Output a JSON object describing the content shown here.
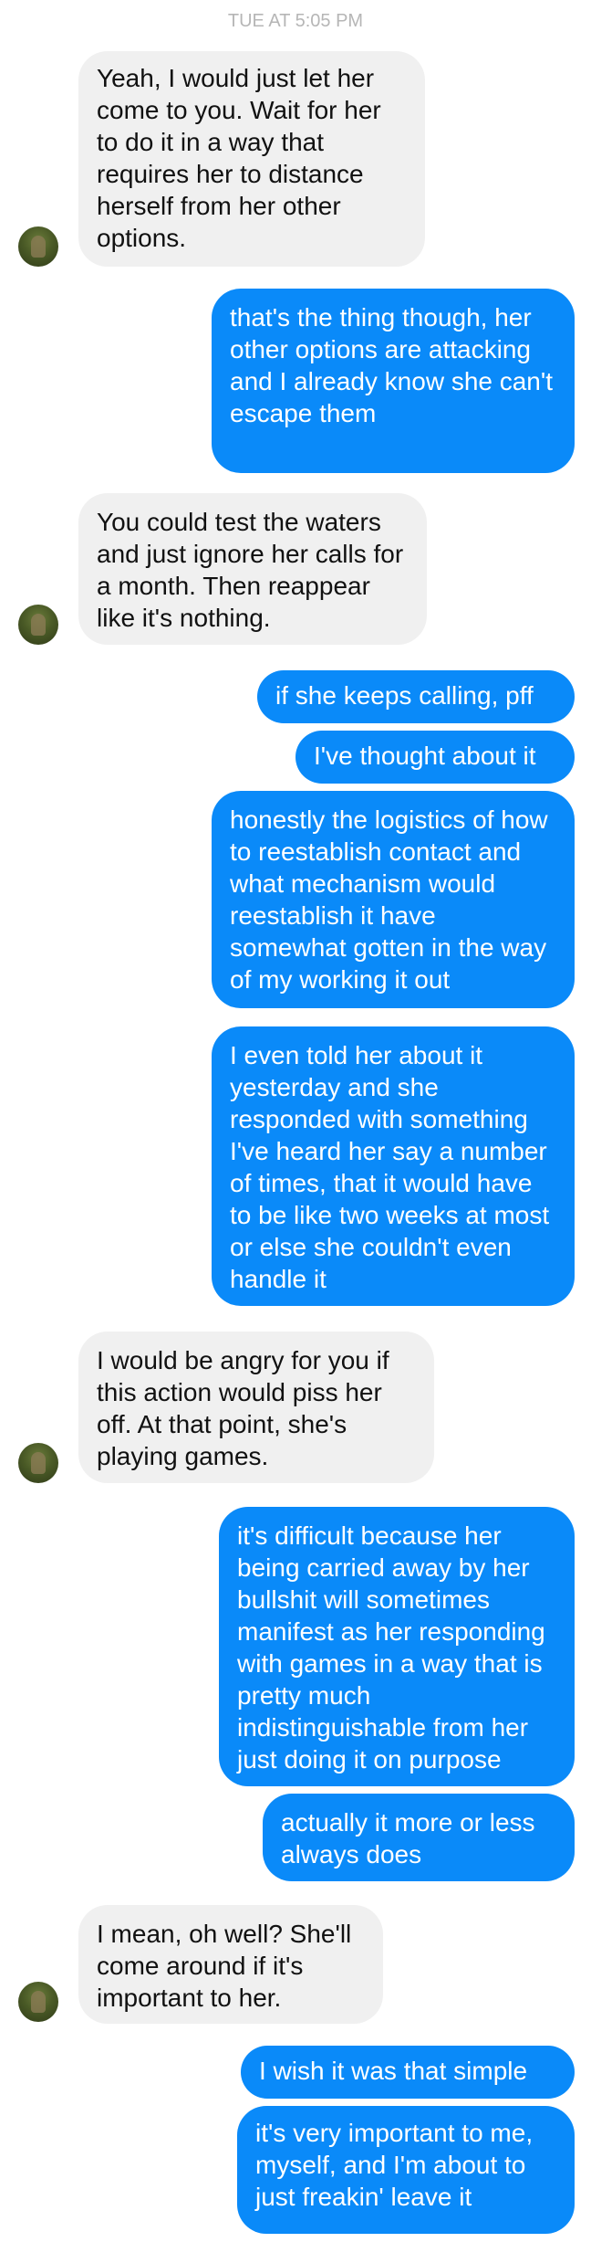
{
  "header": {
    "timestamp": "TUE AT 5:05 PM"
  },
  "messages": [
    {
      "from": "them",
      "text": "Yeah, I would just let her come to you. Wait for her to do it in a way that requires her to distance herself from her other options."
    },
    {
      "from": "me",
      "text": "that's the thing though, her other options are attacking and I already know she can't escape them"
    },
    {
      "from": "them",
      "text": "You could test the waters and just ignore her calls for a month. Then reappear like it's nothing."
    },
    {
      "from": "me",
      "text": "if she keeps calling, pff"
    },
    {
      "from": "me",
      "text": "I've thought about it"
    },
    {
      "from": "me",
      "text": "honestly the logistics of how to reestablish contact and what mechanism would reestablish it have somewhat gotten in the way of my working it out"
    },
    {
      "from": "me",
      "text": "I even told her about it yesterday and she responded with something I've heard her say a number of times, that it would have to be like two weeks at most or else she couldn't even handle it"
    },
    {
      "from": "them",
      "text": "I would be angry for you if this action would piss her off. At that point, she's playing games."
    },
    {
      "from": "me",
      "text": "it's difficult because her being carried away by her bullshit will sometimes manifest as her responding with games in a way that is pretty much indistinguishable from her just doing it on purpose"
    },
    {
      "from": "me",
      "text": "actually it more or less always does"
    },
    {
      "from": "them",
      "text": "I mean, oh well? She'll come around if it's important to her."
    },
    {
      "from": "me",
      "text": "I wish it was that simple"
    },
    {
      "from": "me",
      "text": "it's very important to me, myself, and I'm about to just freakin' leave it"
    }
  ]
}
